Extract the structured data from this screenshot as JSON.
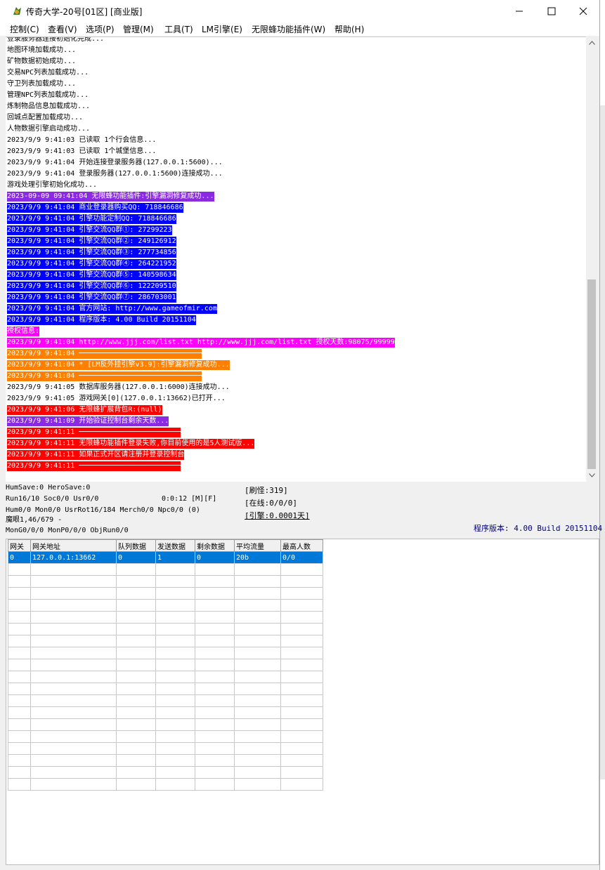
{
  "window": {
    "title": "传奇大学-20号[01区] [商业版]",
    "buttons": {
      "minimize": "—",
      "maximize": "☐",
      "close": "✕"
    }
  },
  "menu": [
    {
      "label": "控制(C)"
    },
    {
      "label": "查看(V)"
    },
    {
      "label": "选项(P)"
    },
    {
      "label": "管理(M)"
    },
    {
      "label": "工具(T)"
    },
    {
      "label": "LM引擎(E)"
    },
    {
      "label": "无限蜂功能插件(W)"
    },
    {
      "label": "帮助(H)"
    }
  ],
  "colors": {
    "purple": "#8a2be2",
    "blue": "#0000ff",
    "magenta": "#ff00ff",
    "orange": "#ff7f00",
    "red": "#ff0000",
    "selection": "#0078d7",
    "version_text": "#000080"
  },
  "log": [
    {
      "text": "登录服务器连接初始化完成...",
      "fg": "#000",
      "bg": ""
    },
    {
      "text": "地图环境加载成功...",
      "fg": "#000",
      "bg": ""
    },
    {
      "text": "矿物数据初始成功...",
      "fg": "#000",
      "bg": ""
    },
    {
      "text": "交易NPC列表加载成功...",
      "fg": "#000",
      "bg": ""
    },
    {
      "text": "守卫列表加载成功...",
      "fg": "#000",
      "bg": ""
    },
    {
      "text": "管理NPC列表加载成功...",
      "fg": "#000",
      "bg": ""
    },
    {
      "text": "炼制物品信息加载成功...",
      "fg": "#000",
      "bg": ""
    },
    {
      "text": "回城点配置加载成功...",
      "fg": "#000",
      "bg": ""
    },
    {
      "text": "人物数据引擎启动成功...",
      "fg": "#000",
      "bg": ""
    },
    {
      "text": "2023/9/9 9:41:03 已读取 1个行会信息...",
      "fg": "#000",
      "bg": ""
    },
    {
      "text": "2023/9/9 9:41:03 已读取 1个城堡信息...",
      "fg": "#000",
      "bg": ""
    },
    {
      "text": "2023/9/9 9:41:04 开始连接登录服务器(127.0.0.1:5600)...",
      "fg": "#000",
      "bg": ""
    },
    {
      "text": "2023/9/9 9:41:04 登录服务器(127.0.0.1:5600)连接成功...",
      "fg": "#000",
      "bg": ""
    },
    {
      "text": "游戏处理引擎初始化成功...",
      "fg": "#000",
      "bg": ""
    },
    {
      "text": "2023-09-09 09:41:04 无限蜂功能插件:引擎漏洞修复成功...",
      "fg": "#fff",
      "bg": "#8a2be2"
    },
    {
      "text": "2023/9/9 9:41:04 商业登录器购买QQ: 718846686",
      "fg": "#fff",
      "bg": "#0000ff"
    },
    {
      "text": "2023/9/9 9:41:04 引擎功能定制QQ: 718846686",
      "fg": "#fff",
      "bg": "#0000ff"
    },
    {
      "text": "2023/9/9 9:41:04 引擎交流QQ群①: 27299223",
      "fg": "#fff",
      "bg": "#0000ff"
    },
    {
      "text": "2023/9/9 9:41:04 引擎交流QQ群②: 249126912",
      "fg": "#fff",
      "bg": "#0000ff"
    },
    {
      "text": "2023/9/9 9:41:04 引擎交流QQ群③: 277734856",
      "fg": "#fff",
      "bg": "#0000ff"
    },
    {
      "text": "2023/9/9 9:41:04 引擎交流QQ群④: 264221952",
      "fg": "#fff",
      "bg": "#0000ff"
    },
    {
      "text": "2023/9/9 9:41:04 引擎交流QQ群⑤: 140598634",
      "fg": "#fff",
      "bg": "#0000ff"
    },
    {
      "text": "2023/9/9 9:41:04 引擎交流QQ群⑥: 122209510",
      "fg": "#fff",
      "bg": "#0000ff"
    },
    {
      "text": "2023/9/9 9:41:04 引擎交流QQ群⑦: 286703001",
      "fg": "#fff",
      "bg": "#0000ff"
    },
    {
      "text": "2023/9/9 9:41:04 官方网站: http://www.gameofmir.com",
      "fg": "#fff",
      "bg": "#0000ff"
    },
    {
      "text": "2023/9/9 9:41:04 程序版本: 4.00 Build 20151104",
      "fg": "#fff",
      "bg": "#0000ff"
    },
    {
      "text": "授权信息:",
      "fg": "#fff",
      "bg": "#ff00ff"
    },
    {
      "text": "2023/9/9 9:41:04 http://www.jjj.com/list.txt http://www.jjj.com/list.txt 授权天数:98075/99999",
      "fg": "#fff",
      "bg": "#ff00ff"
    },
    {
      "text": "2023/9/9 9:41:04 ─────────────────────────────",
      "fg": "#fff",
      "bg": "#ff7f00"
    },
    {
      "text": "2023/9/9 9:41:04 * [LM反外挂引擎v3.9]:引擎漏洞修复成功...",
      "fg": "#fff",
      "bg": "#ff7f00"
    },
    {
      "text": "2023/9/9 9:41:04 ─────────────────────────────",
      "fg": "#fff",
      "bg": "#ff7f00"
    },
    {
      "text": "2023/9/9 9:41:05 数据库服务器(127.0.0.1:6000)连接成功...",
      "fg": "#000",
      "bg": ""
    },
    {
      "text": "2023/9/9 9:41:05 游戏网关[0](127.0.0.1:13662)已打开...",
      "fg": "#000",
      "bg": ""
    },
    {
      "text": "2023/9/9 9:41:06 无限蜂扩展背包R:(null)",
      "fg": "#fff",
      "bg": "#ff0000"
    },
    {
      "text": "2023/9/9 9:41:09 开始验证控制台剩余天数...",
      "fg": "#fff",
      "bg": "#8a2be2"
    },
    {
      "text": "2023/9/9 9:41:11 ────────────────────────",
      "fg": "#fff",
      "bg": "#ff0000"
    },
    {
      "text": "2023/9/9 9:41:11 无限蜂功能插件登录失败,你目前使用的是5人测试版...",
      "fg": "#fff",
      "bg": "#ff0000"
    },
    {
      "text": "2023/9/9 9:41:11 如果正式开区请注册并登录控制台",
      "fg": "#fff",
      "bg": "#ff0000"
    },
    {
      "text": "2023/9/9 9:41:11 ────────────────────────",
      "fg": "#fff",
      "bg": "#ff0000"
    }
  ],
  "status": {
    "line1": "HumSave:0 HeroSave:0",
    "line2": "Run16/10 Soc0/0 Usr0/0",
    "time": "0:0:12 [M][F]",
    "line3": "Hum0/0 Mon0/0 UsrRot16/184 Merch0/0 Npc0/0 (0)",
    "line4": "魔眼1,46/679 -",
    "line5": "MonG0/0/0 MonP0/0/0 ObjRun0/0",
    "monster": "[刷怪:319]",
    "online": "[在线:0/0/0]",
    "engine": "[引擎:0.0001天]",
    "version": "程序版本: 4.00 Build 20151104"
  },
  "gateway_table": {
    "columns": [
      "网关",
      "网关地址",
      "队列数据",
      "发送数据",
      "剩余数据",
      "平均流量",
      "最高人数"
    ],
    "rows": [
      [
        "0",
        "127.0.0.1:13662",
        "0",
        "1",
        "0",
        "20b",
        "0/0"
      ]
    ],
    "empty_rows": 19
  }
}
